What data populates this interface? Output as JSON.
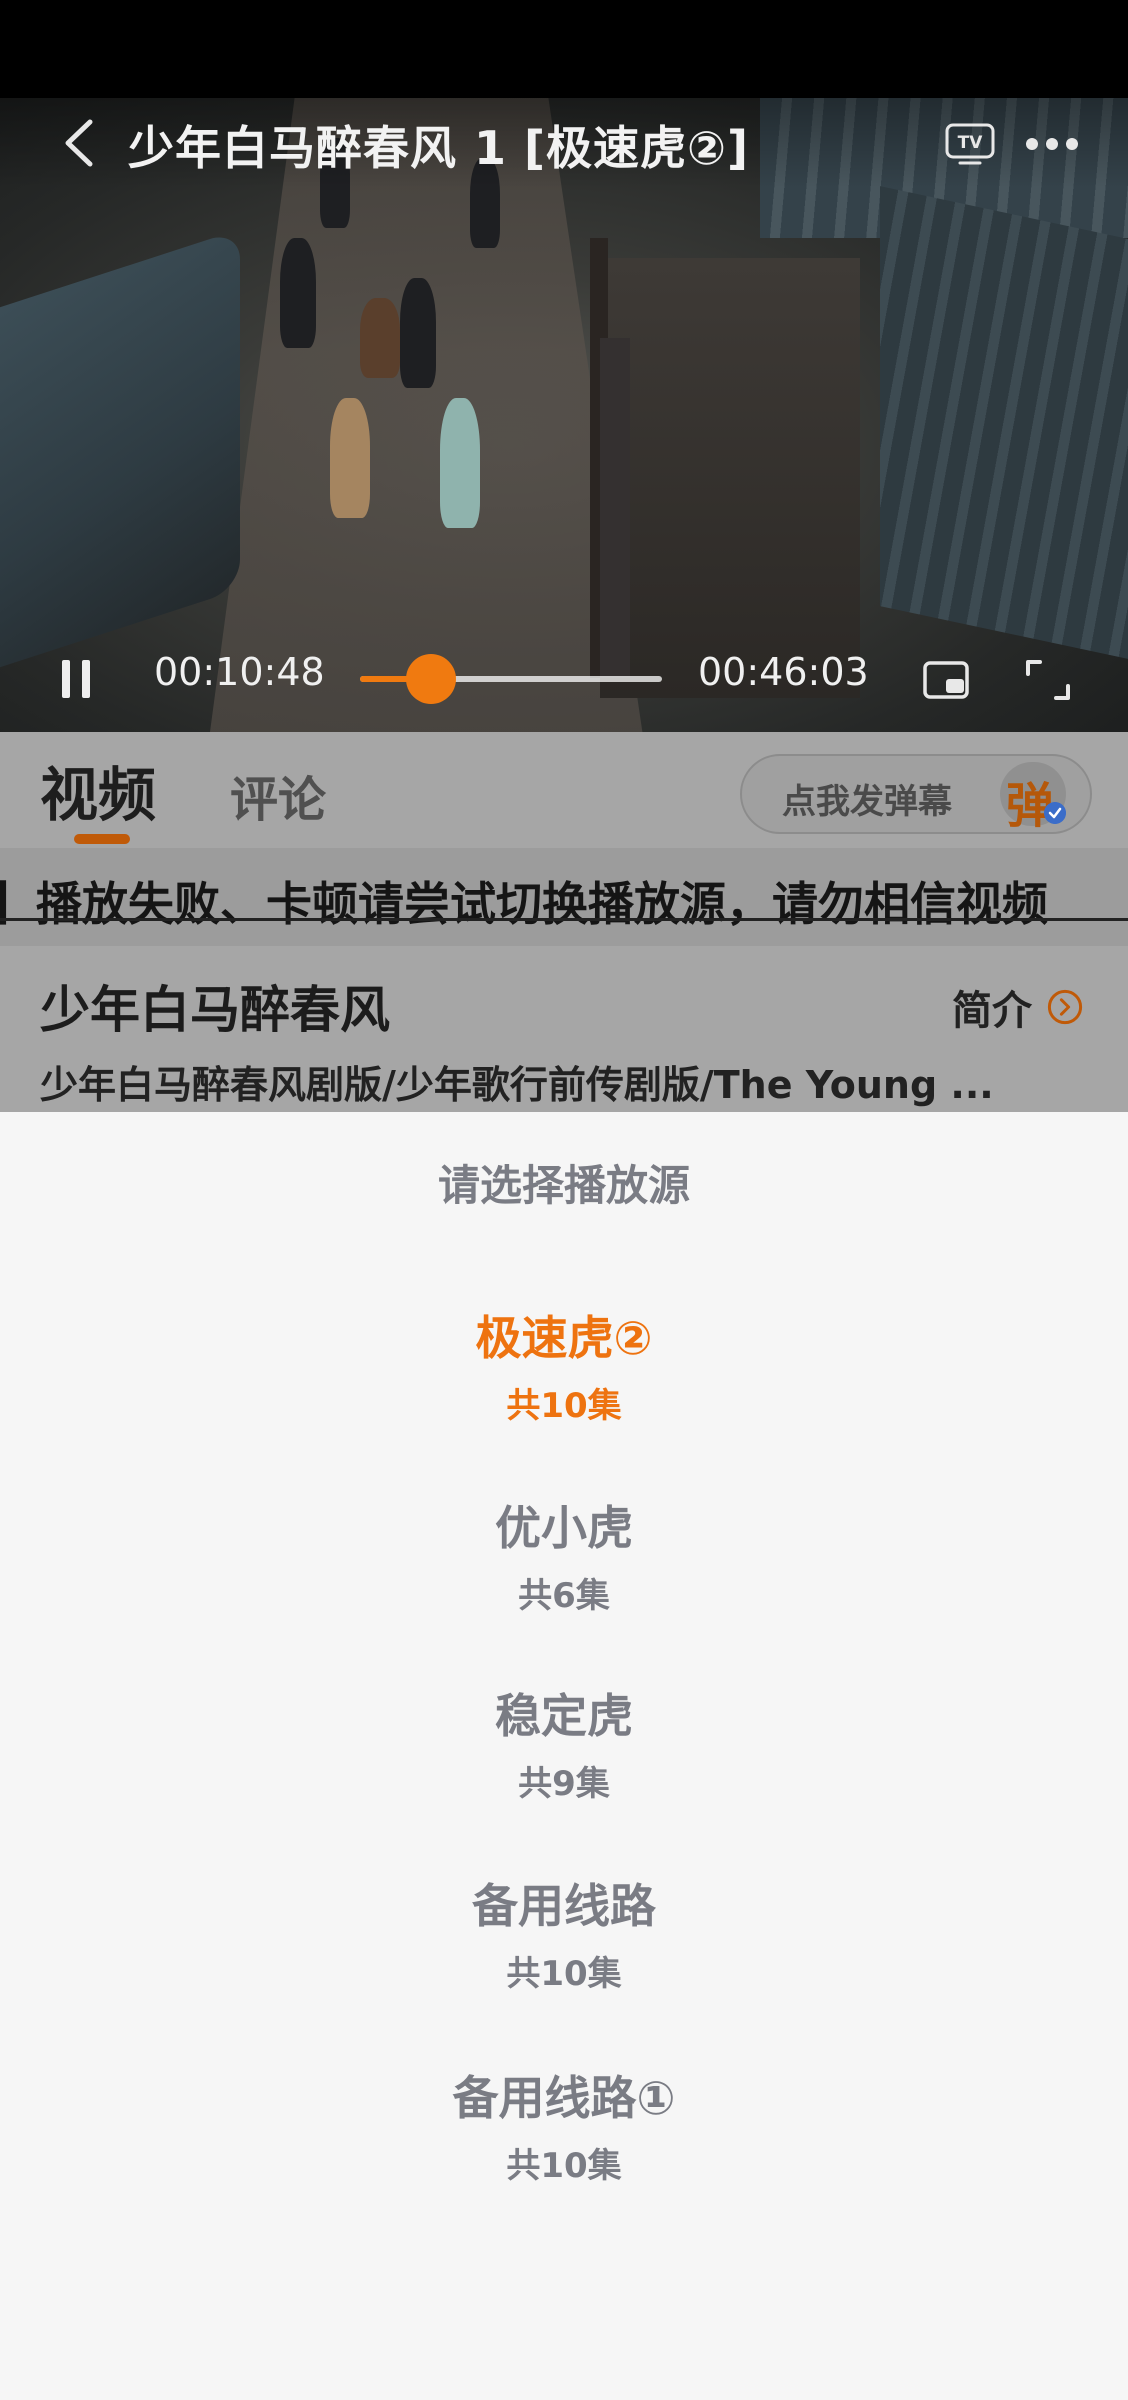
{
  "player": {
    "title": "少年白马醉春风 1 [极速虎②]",
    "current_time": "00:10:48",
    "total_time": "00:46:03",
    "progress_fraction": 0.235,
    "accent_color": "#f07a10",
    "icons": {
      "back": "back-chevron-icon",
      "tv": "tv-cast-icon",
      "more": "more-dots-icon",
      "pause": "pause-icon",
      "pip": "picture-in-picture-icon",
      "fullscreen": "fullscreen-icon"
    },
    "tv_label": "TV"
  },
  "tabs": [
    {
      "label": "视频",
      "active": true
    },
    {
      "label": "评论",
      "active": false
    }
  ],
  "danmaku": {
    "label": "点我发弹幕",
    "icon_char": "弹"
  },
  "notice": {
    "text": "】播放失败、卡顿请尝试切换播放源，请勿相信视频"
  },
  "show": {
    "title": "少年白马醉春风",
    "intro_label": "简介",
    "alt_names": "少年白马醉春风剧版/少年歌行前传剧版/The Young ..."
  },
  "source_sheet": {
    "title": "请选择播放源",
    "sources": [
      {
        "name": "极速虎②",
        "count": "共10集",
        "selected": true
      },
      {
        "name": "优小虎",
        "count": "共6集",
        "selected": false
      },
      {
        "name": "稳定虎",
        "count": "共9集",
        "selected": false
      },
      {
        "name": "备用线路",
        "count": "共10集",
        "selected": false
      },
      {
        "name": "备用线路①",
        "count": "共10集",
        "selected": false
      }
    ]
  }
}
